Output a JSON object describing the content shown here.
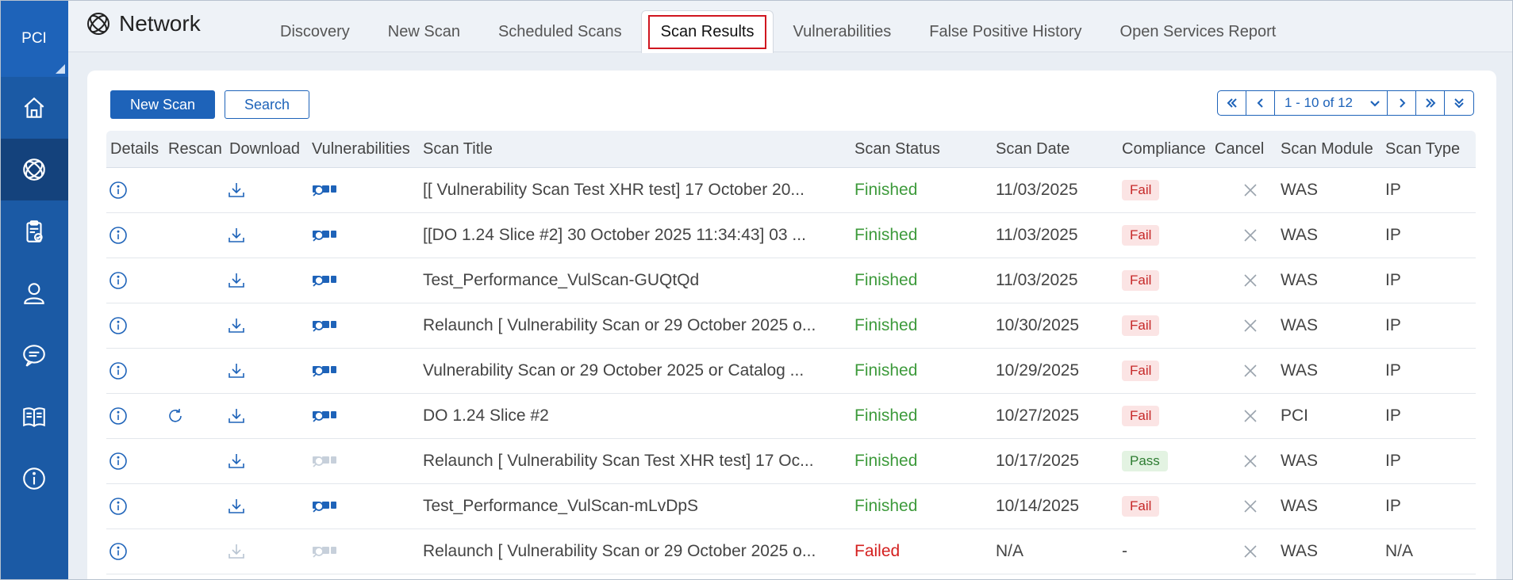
{
  "app": {
    "rail_label": "PCI",
    "title": "Network"
  },
  "rail": [
    {
      "icon": "home-icon"
    },
    {
      "icon": "network-icon",
      "active": true
    },
    {
      "icon": "clipboard-check-icon"
    },
    {
      "icon": "user-icon"
    },
    {
      "icon": "chat-icon"
    },
    {
      "icon": "book-icon"
    },
    {
      "icon": "info-icon"
    }
  ],
  "tabs": [
    "Discovery",
    "New Scan",
    "Scheduled Scans",
    "Scan Results",
    "Vulnerabilities",
    "False Positive History",
    "Open Services Report"
  ],
  "active_tab": "Scan Results",
  "toolbar": {
    "new_scan": "New Scan",
    "search": "Search"
  },
  "pager": {
    "range": "1 - 10 of 12"
  },
  "columns": [
    "Details",
    "Rescan",
    "Download",
    "Vulnerabilities",
    "Scan Title",
    "Scan Status",
    "Scan Date",
    "Compliance",
    "Cancel",
    "Scan Module",
    "Scan Type"
  ],
  "rows": [
    {
      "rescan": false,
      "download": true,
      "vuln": true,
      "title": "[[ Vulnerability Scan Test XHR test] 17 October 20...",
      "status": "Finished",
      "date": "11/03/2025",
      "compliance": "Fail",
      "module": "WAS",
      "type": "IP"
    },
    {
      "rescan": false,
      "download": true,
      "vuln": true,
      "title": "[[DO 1.24 Slice #2] 30 October 2025 11:34:43] 03 ...",
      "status": "Finished",
      "date": "11/03/2025",
      "compliance": "Fail",
      "module": "WAS",
      "type": "IP"
    },
    {
      "rescan": false,
      "download": true,
      "vuln": true,
      "title": "Test_Performance_VulScan-GUQtQd",
      "status": "Finished",
      "date": "11/03/2025",
      "compliance": "Fail",
      "module": "WAS",
      "type": "IP"
    },
    {
      "rescan": false,
      "download": true,
      "vuln": true,
      "title": "Relaunch [ Vulnerability Scan or 29 October 2025 o...",
      "status": "Finished",
      "date": "10/30/2025",
      "compliance": "Fail",
      "module": "WAS",
      "type": "IP"
    },
    {
      "rescan": false,
      "download": true,
      "vuln": true,
      "title": "Vulnerability Scan or 29 October 2025 or Catalog ...",
      "status": "Finished",
      "date": "10/29/2025",
      "compliance": "Fail",
      "module": "WAS",
      "type": "IP"
    },
    {
      "rescan": true,
      "download": true,
      "vuln": true,
      "title": "DO 1.24 Slice #2",
      "status": "Finished",
      "date": "10/27/2025",
      "compliance": "Fail",
      "module": "PCI",
      "type": "IP"
    },
    {
      "rescan": false,
      "download": true,
      "vuln": false,
      "title": "Relaunch [ Vulnerability Scan Test XHR test] 17 Oc...",
      "status": "Finished",
      "date": "10/17/2025",
      "compliance": "Pass",
      "module": "WAS",
      "type": "IP"
    },
    {
      "rescan": false,
      "download": true,
      "vuln": true,
      "title": "Test_Performance_VulScan-mLvDpS",
      "status": "Finished",
      "date": "10/14/2025",
      "compliance": "Fail",
      "module": "WAS",
      "type": "IP"
    },
    {
      "rescan": false,
      "download": false,
      "vuln": false,
      "title": "Relaunch [ Vulnerability Scan or 29 October 2025 o...",
      "status": "Failed",
      "date": "N/A",
      "compliance": "-",
      "module": "WAS",
      "type": "N/A"
    }
  ],
  "colors": {
    "rail": "#1b5aa5",
    "accent": "#1e63b9",
    "finished": "#3d9a3b",
    "failed": "#d4201f",
    "tab_highlight": "#d0161f"
  }
}
